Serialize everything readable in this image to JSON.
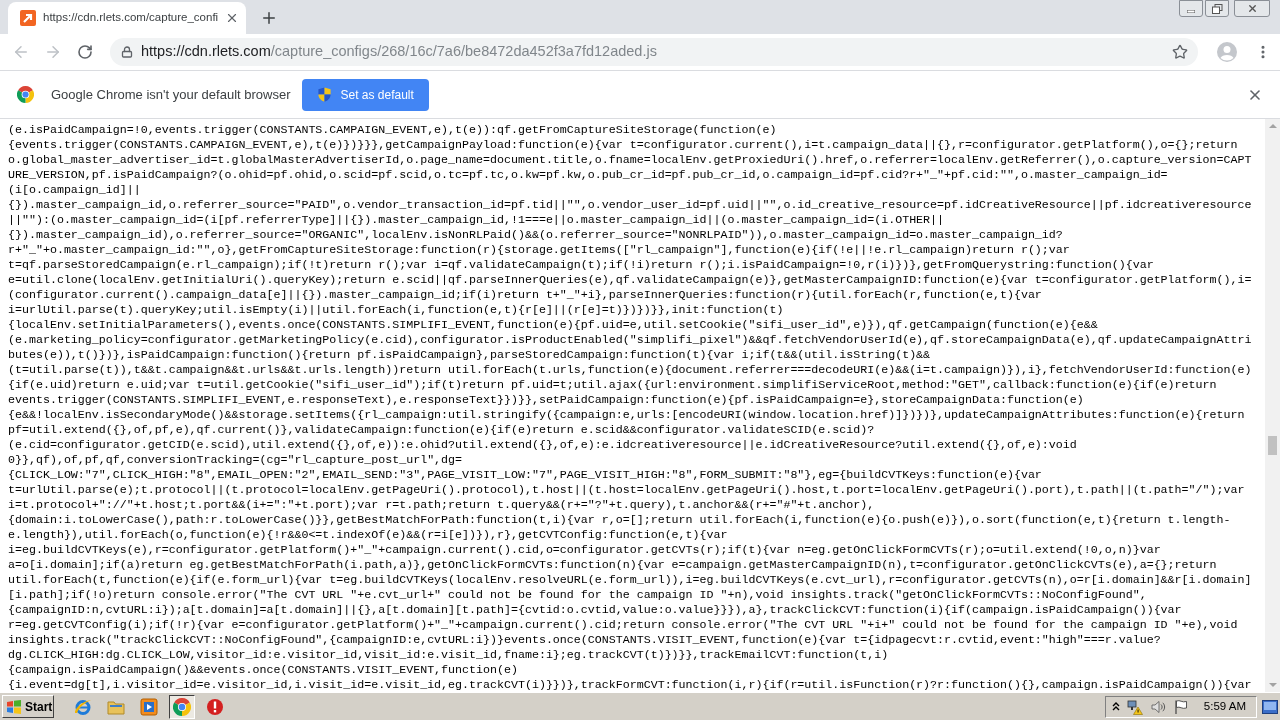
{
  "tabs": [
    {
      "title": "https://cdn.rlets.com/capture_confi",
      "selected": true
    }
  ],
  "toolbar": {
    "nav": [
      {
        "kind": "back",
        "disabled": true
      },
      {
        "kind": "forward",
        "disabled": true
      },
      {
        "kind": "reload",
        "disabled": false
      }
    ],
    "address": {
      "host": "https://cdn.rlets.com",
      "path": "/capture_configs/268/16c/7a6/be8472da452f3a7fd12aded.js"
    }
  },
  "infobar": {
    "message": "Google Chrome isn't your default browser",
    "button": "Set as default"
  },
  "code_lines": [
    "(e.isPaidCampaign=!0,events.trigger(CONSTANTS.CAMPAIGN_EVENT,e),t(e)):qf.getFromCaptureSiteStorage(function(e)",
    "{events.trigger(CONSTANTS.CAMPAIGN_EVENT,e),t(e)})}}},getCampaignPayload:function(e){var t=configurator.current(),i=t.campaign_data||{},r=configurator.getPlatform(),o={};return",
    "o.global_master_advertiser_id=t.globalMasterAdvertiserId,o.page_name=document.title,o.fname=localEnv.getProxiedUri().href,o.referrer=localEnv.getReferrer(),o.capture_version=CAPT",
    "URE_VERSION,pf.isPaidCampaign?(o.ohid=pf.ohid,o.scid=pf.scid,o.tc=pf.tc,o.kw=pf.kw,o.pub_cr_id=pf.pub_cr_id,o.campaign_id=pf.cid?r+\"_\"+pf.cid:\"\",o.master_campaign_id=",
    "(i[o.campaign_id]||",
    "{}).master_campaign_id,o.referrer_source=\"PAID\",o.vendor_transaction_id=pf.tid||\"\",o.vendor_user_id=pf.uid||\"\",o.id_creative_resource=pf.idCreativeResource||pf.idcreativeresource",
    "||\"\"):(o.master_campaign_id=(i[pf.referrerType]||{}).master_campaign_id,!1===e||o.master_campaign_id||(o.master_campaign_id=(i.OTHER||",
    "{}).master_campaign_id),o.referrer_source=\"ORGANIC\",localEnv.isNonRLPaid()&&(o.referrer_source=\"NONRLPAID\")),o.master_campaign_id=o.master_campaign_id?",
    "r+\"_\"+o.master_campaign_id:\"\",o},getFromCaptureSiteStorage:function(r){storage.getItems([\"rl_campaign\"],function(e){if(!e||!e.rl_campaign)return r();var",
    "t=qf.parseStoredCampaign(e.rl_campaign);if(!t)return r();var i=qf.validateCampaign(t);if(!i)return r();i.isPaidCampaign=!0,r(i)})},getFromQuerystring:function(){var",
    "e=util.clone(localEnv.getInitialUri().queryKey);return e.scid||qf.parseInnerQueries(e),qf.validateCampaign(e)},getMasterCampaignID:function(e){var t=configurator.getPlatform(),i=",
    "(configurator.current().campaign_data[e]||{}).master_campaign_id;if(i)return t+\"_\"+i},parseInnerQueries:function(r){util.forEach(r,function(e,t){var",
    "i=urlUtil.parse(t).queryKey;util.isEmpty(i)||util.forEach(i,function(e,t){r[e]||(r[e]=t)})})}},init:function(t)",
    "{localEnv.setInitialParameters(),events.once(CONSTANTS.SIMPLIFI_EVENT,function(e){pf.uid=e,util.setCookie(\"sifi_user_id\",e)}),qf.getCampaign(function(e){e&&",
    "(e.marketing_policy=configurator.getMarketingPolicy(e.cid),configurator.isProductEnabled(\"simplifi_pixel\")&&qf.fetchVendorUserId(e),qf.storeCampaignData(e),qf.updateCampaignAttri",
    "butes(e)),t()})},isPaidCampaign:function(){return pf.isPaidCampaign},parseStoredCampaign:function(t){var i;if(t&&(util.isString(t)&&",
    "(t=util.parse(t)),t&&t.campaign&&t.urls&&t.urls.length))return util.forEach(t.urls,function(e){document.referrer===decodeURI(e)&&(i=t.campaign)}),i},fetchVendorUserId:function(e)",
    "{if(e.uid)return e.uid;var t=util.getCookie(\"sifi_user_id\");if(t)return pf.uid=t;util.ajax({url:environment.simplifiServiceRoot,method:\"GET\",callback:function(e){if(e)return",
    "events.trigger(CONSTANTS.SIMPLIFI_EVENT,e.responseText),e.responseText}})}},setPaidCampaign:function(e){pf.isPaidCampaign=e},storeCampaignData:function(e)",
    "{e&&!localEnv.isSecondaryMode()&&storage.setItems({rl_campaign:util.stringify({campaign:e,urls:[encodeURI(window.location.href)]})})},updateCampaignAttributes:function(e){return",
    "pf=util.extend({},of,pf,e),qf.current()},validateCampaign:function(e){if(e)return e.scid&&configurator.validateSCID(e.scid)?",
    "(e.cid=configurator.getCID(e.scid),util.extend({},of,e)):e.ohid?util.extend({},of,e):e.idcreativeresource||e.idCreativeResource?util.extend({},of,e):void",
    "0}},qf),of,pf,qf,conversionTracking=(cg=\"rl_capture_post_url\",dg=",
    "{CLICK_LOW:\"7\",CLICK_HIGH:\"8\",EMAIL_OPEN:\"2\",EMAIL_SEND:\"3\",PAGE_VISIT_LOW:\"7\",PAGE_VISIT_HIGH:\"8\",FORM_SUBMIT:\"8\"},eg={buildCVTKeys:function(e){var",
    "t=urlUtil.parse(e);t.protocol||(t.protocol=localEnv.getPageUri().protocol),t.host||(t.host=localEnv.getPageUri().host,t.port=localEnv.getPageUri().port),t.path||(t.path=\"/\");var",
    "i=t.protocol+\"://\"+t.host;t.port&&(i+=\":\"+t.port);var r=t.path;return t.query&&(r+=\"?\"+t.query),t.anchor&&(r+=\"#\"+t.anchor),",
    "{domain:i.toLowerCase(),path:r.toLowerCase()}},getBestMatchForPath:function(t,i){var r,o=[];return util.forEach(i,function(e){o.push(e)}),o.sort(function(e,t){return t.length-",
    "e.length}),util.forEach(o,function(e){!r&&0<=t.indexOf(e)&&(r=i[e])}),r},getCVTConfig:function(e,t){var",
    "i=eg.buildCVTKeys(e),r=configurator.getPlatform()+\"_\"+campaign.current().cid,o=configurator.getCVTs(r);if(t){var n=eg.getOnClickFormCVTs(r);o=util.extend(!0,o,n)}var",
    "a=o[i.domain];if(a)return eg.getBestMatchForPath(i.path,a)},getOnClickFormCVTs:function(n){var e=campaign.getMasterCampaignID(n),t=configurator.getOnClickCVTs(e),a={};return",
    "util.forEach(t,function(e){if(e.form_url){var t=eg.buildCVTKeys(localEnv.resolveURL(e.form_url)),i=eg.buildCVTKeys(e.cvt_url),r=configurator.getCVTs(n),o=r[i.domain]&&r[i.domain]",
    "[i.path];if(!o)return console.error(\"The CVT URL \"+e.cvt_url+\" could not be found for the campaign ID \"+n),void insights.track(\"getOnClickFormCVTs::NoConfigFound\",",
    "{campaignID:n,cvtURL:i});a[t.domain]=a[t.domain]||{},a[t.domain][t.path]={cvtid:o.cvtid,value:o.value}}}),a},trackClickCVT:function(i){if(campaign.isPaidCampaign()){var",
    "r=eg.getCVTConfig(i);if(!r){var e=configurator.getPlatform()+\"_\"+campaign.current().cid;return console.error(\"The CVT URL \"+i+\" could not be found for the campaign ID \"+e),void",
    "insights.track(\"trackClickCVT::NoConfigFound\",{campaignID:e,cvtURL:i})}events.once(CONSTANTS.VISIT_EVENT,function(e){var t={idpagecvt:r.cvtid,event:\"high\"===r.value?",
    "dg.CLICK_HIGH:dg.CLICK_LOW,visitor_id:e.visitor_id,visit_id:e.visit_id,fname:i};eg.trackCVT(t)})}},trackEmailCVT:function(t,i)",
    "{campaign.isPaidCampaign()&&events.once(CONSTANTS.VISIT_EVENT,function(e)",
    "{i.event=dg[t],i.visitor_id=e.visitor_id,i.visit_id=e.visit_id,eg.trackCVT(i)}})},trackFormCVT:function(i,r){if(r=util.isFunction(r)?r:function(){},campaign.isPaidCampaign()){var"
  ],
  "taskbar": {
    "start": "Start",
    "apps": [
      {
        "kind": "ie",
        "selected": false
      },
      {
        "kind": "folder",
        "selected": false
      },
      {
        "kind": "media",
        "selected": false
      },
      {
        "kind": "chrome",
        "selected": true
      },
      {
        "kind": "alert",
        "selected": false
      }
    ],
    "clock": "5:59 AM"
  }
}
